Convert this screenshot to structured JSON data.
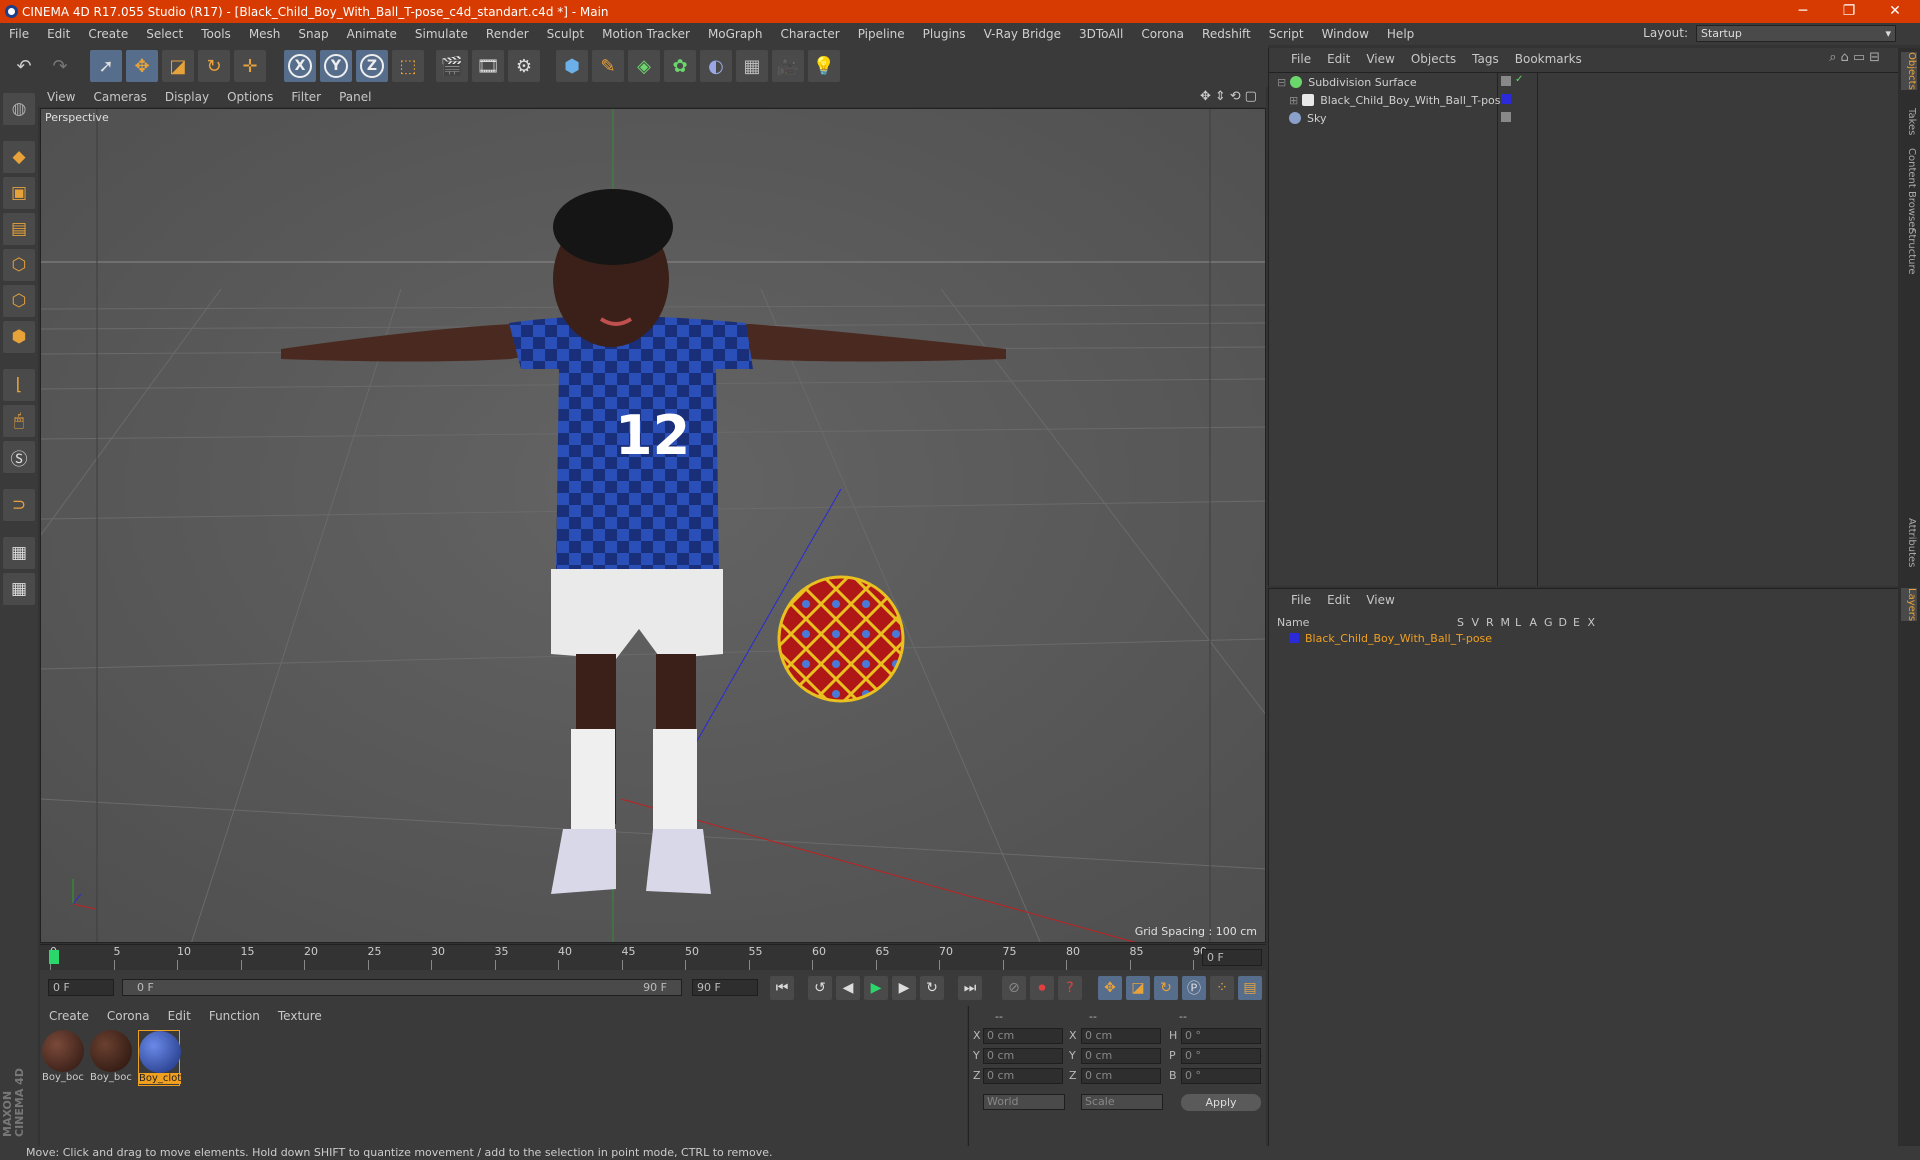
{
  "window": {
    "title": "CINEMA 4D R17.055 Studio (R17) - [Black_Child_Boy_With_Ball_T-pose_c4d_standart.c4d *] - Main",
    "minimize": "─",
    "restore": "❐",
    "close": "✕"
  },
  "menubar": {
    "items": [
      "File",
      "Edit",
      "Create",
      "Select",
      "Tools",
      "Mesh",
      "Snap",
      "Animate",
      "Simulate",
      "Render",
      "Sculpt",
      "Motion Tracker",
      "MoGraph",
      "Character",
      "Pipeline",
      "Plugins",
      "V-Ray Bridge",
      "3DToAll",
      "Corona",
      "Redshift",
      "Script",
      "Window",
      "Help"
    ],
    "layout_label": "Layout:",
    "layout_value": "Startup"
  },
  "toolbar": {
    "icons": [
      "undo-icon",
      "redo-icon",
      "select-icon",
      "move-icon",
      "scale-icon",
      "rotate-icon",
      "add-icon",
      "x-axis-icon",
      "y-axis-icon",
      "z-axis-icon",
      "coord-system-icon",
      "render-view-icon",
      "render-picture-viewer-icon",
      "edit-render-settings-icon",
      "cube-icon",
      "pen-icon",
      "subdivision-icon",
      "cloner-icon",
      "deformer-icon",
      "floor-icon",
      "camera-icon",
      "light-icon"
    ],
    "axis_x": "X",
    "axis_y": "Y",
    "axis_z": "Z"
  },
  "viewport": {
    "menu": [
      "View",
      "Cameras",
      "Display",
      "Options",
      "Filter",
      "Panel"
    ],
    "label": "Perspective",
    "grid_spacing": "Grid Spacing : 100 cm",
    "jersey_number": "12"
  },
  "timeline": {
    "ticks": [
      "0",
      "5",
      "10",
      "15",
      "20",
      "25",
      "30",
      "35",
      "40",
      "45",
      "50",
      "55",
      "60",
      "65",
      "70",
      "75",
      "80",
      "85",
      "90"
    ],
    "current_frame": "0 F",
    "start_field": "0 F",
    "slider_start": "0 F",
    "slider_end": "90 F",
    "end_field": "90 F"
  },
  "materials": {
    "menu": [
      "Create",
      "Corona",
      "Edit",
      "Function",
      "Texture"
    ],
    "items": [
      {
        "label": "Boy_boc"
      },
      {
        "label": "Boy_boc"
      },
      {
        "label": "Boy_clot"
      }
    ]
  },
  "coordinates": {
    "headers": [
      "--",
      "--",
      "--"
    ],
    "rows": [
      {
        "axis": "X",
        "pos": "0 cm",
        "axis2": "X",
        "size": "0 cm",
        "rot_label": "H",
        "rot": "0 °"
      },
      {
        "axis": "Y",
        "pos": "0 cm",
        "axis2": "Y",
        "size": "0 cm",
        "rot_label": "P",
        "rot": "0 °"
      },
      {
        "axis": "Z",
        "pos": "0 cm",
        "axis2": "Z",
        "size": "0 cm",
        "rot_label": "B",
        "rot": "0 °"
      }
    ],
    "world": "World",
    "scale": "Scale",
    "apply": "Apply"
  },
  "objects_panel": {
    "menu": [
      "File",
      "Edit",
      "View",
      "Objects",
      "Tags",
      "Bookmarks"
    ],
    "items": [
      {
        "name": "Subdivision Surface",
        "color": "#6bd66b"
      },
      {
        "name": "Black_Child_Boy_With_Ball_T-pose",
        "color": "#e8e8e8"
      },
      {
        "name": "Sky",
        "color": "#8aa0c8"
      }
    ]
  },
  "layers_panel": {
    "menu": [
      "File",
      "Edit",
      "View"
    ],
    "col_name": "Name",
    "cols": [
      "S",
      "V",
      "R",
      "M",
      "L",
      "A",
      "G",
      "D",
      "E",
      "X"
    ],
    "layer_name": "Black_Child_Boy_With_Ball_T-pose",
    "layer_color": "#2a2ad8"
  },
  "side_tabs": [
    "Objects",
    "Takes",
    "Content Browser",
    "Structure",
    "Attributes",
    "Layers"
  ],
  "branding": "MAXON CINEMA 4D",
  "status": "Move: Click and drag to move elements. Hold down SHIFT to quantize movement / add to the selection in point mode, CTRL to remove.",
  "colors": {
    "title_bar": "#d83b01",
    "accent": "#e8a23a",
    "highlight_text": "#f0a020"
  }
}
